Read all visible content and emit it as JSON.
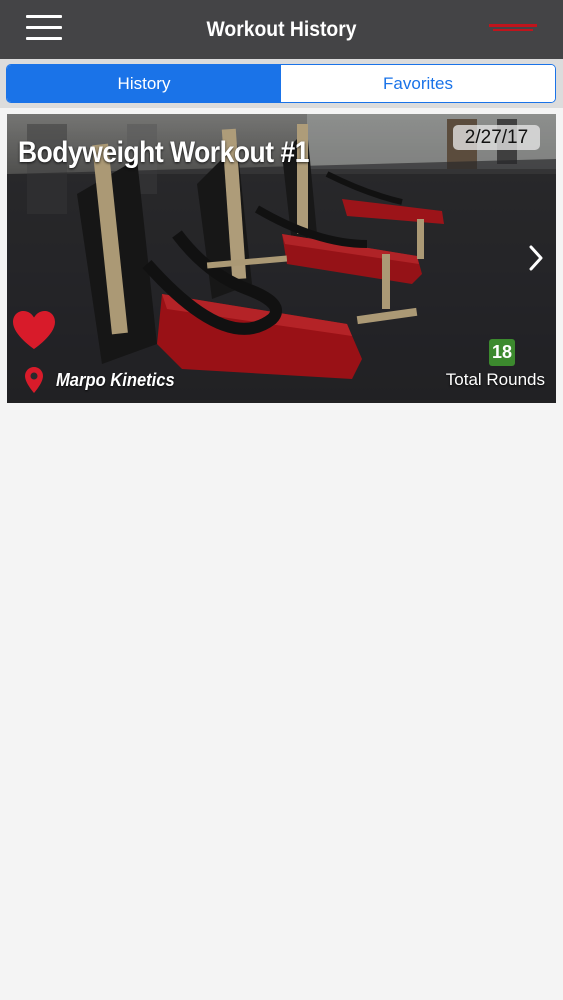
{
  "header": {
    "title": "Workout History",
    "menu_icon": "hamburger-menu-icon",
    "brand_icon": "brand-logo-icon"
  },
  "tabs": [
    {
      "label": "History",
      "active": true
    },
    {
      "label": "Favorites",
      "active": false
    }
  ],
  "workouts": [
    {
      "title": "Bodyweight Workout #1",
      "date": "2/27/17",
      "location": "Marpo Kinetics",
      "total_rounds": "18",
      "total_rounds_label": "Total Rounds",
      "favorited": true
    }
  ],
  "colors": {
    "navbar": "#444446",
    "accent_blue": "#1a73e8",
    "heart_red": "#d81b2a",
    "rounds_green": "#3c8a2e"
  }
}
